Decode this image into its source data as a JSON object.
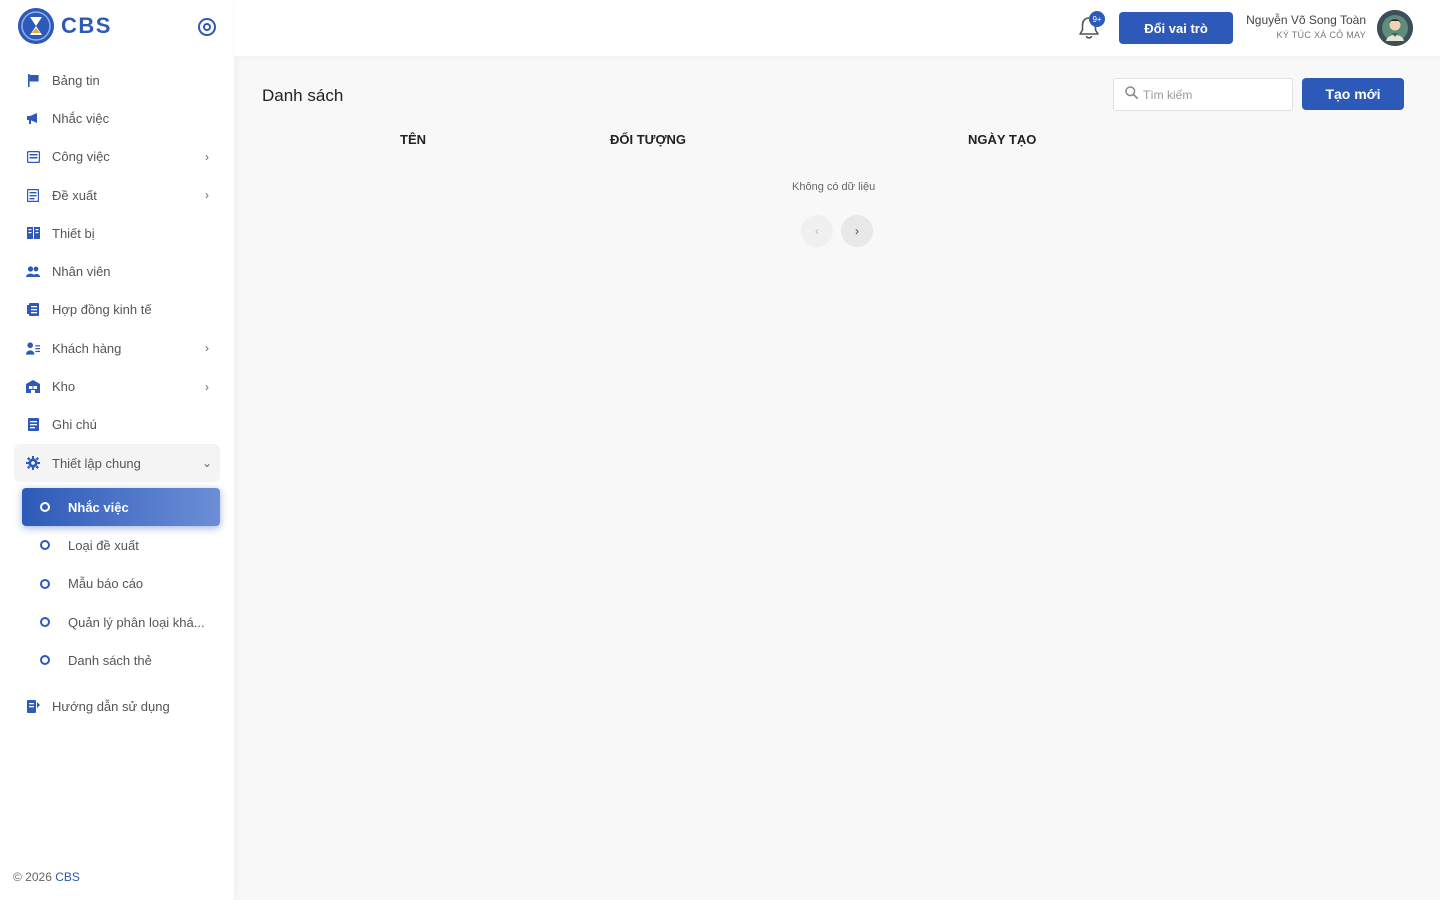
{
  "brand": {
    "name": "CBS"
  },
  "sidebar": {
    "items": [
      {
        "label": "Bảng tin",
        "icon": "flag-icon"
      },
      {
        "label": "Nhắc việc",
        "icon": "megaphone-icon"
      },
      {
        "label": "Công việc",
        "icon": "tasks-icon",
        "expandable": true
      },
      {
        "label": "Đề xuất",
        "icon": "proposal-icon",
        "expandable": true
      },
      {
        "label": "Thiết bị",
        "icon": "device-icon"
      },
      {
        "label": "Nhân viên",
        "icon": "users-icon"
      },
      {
        "label": "Hợp đồng kinh tế",
        "icon": "contract-icon"
      },
      {
        "label": "Khách hàng",
        "icon": "customer-icon",
        "expandable": true
      },
      {
        "label": "Kho",
        "icon": "warehouse-icon",
        "expandable": true
      },
      {
        "label": "Ghi chú",
        "icon": "note-icon"
      },
      {
        "label": "Thiết lập chung",
        "icon": "gear-icon",
        "expandable": true,
        "expanded": true
      }
    ],
    "subitems": [
      {
        "label": "Nhắc việc",
        "active": true
      },
      {
        "label": "Loại đề xuất"
      },
      {
        "label": "Mẫu báo cáo"
      },
      {
        "label": "Quản lý phân loại khá..."
      },
      {
        "label": "Danh sách thẻ"
      }
    ],
    "bottom_item": {
      "label": "Hướng dẫn sử dụng",
      "icon": "guide-icon"
    },
    "footer": {
      "copyright": "© 2026",
      "brand": "CBS"
    }
  },
  "header": {
    "notification_badge": "9+",
    "role_button": "Đổi vai trò",
    "user_name": "Nguyễn Võ Song Toàn",
    "user_org": "KÝ TÚC XÁ CỎ MAY"
  },
  "main": {
    "title": "Danh sách",
    "search_placeholder": "Tìm kiếm",
    "create_button": "Tạo mới",
    "columns": [
      "TÊN",
      "ĐỐI TƯỢNG",
      "NGÀY TẠO"
    ],
    "empty_text": "Không có dữ liệu"
  },
  "colors": {
    "accent": "#2d5ab8",
    "accent_light": "#6c8ed6"
  }
}
